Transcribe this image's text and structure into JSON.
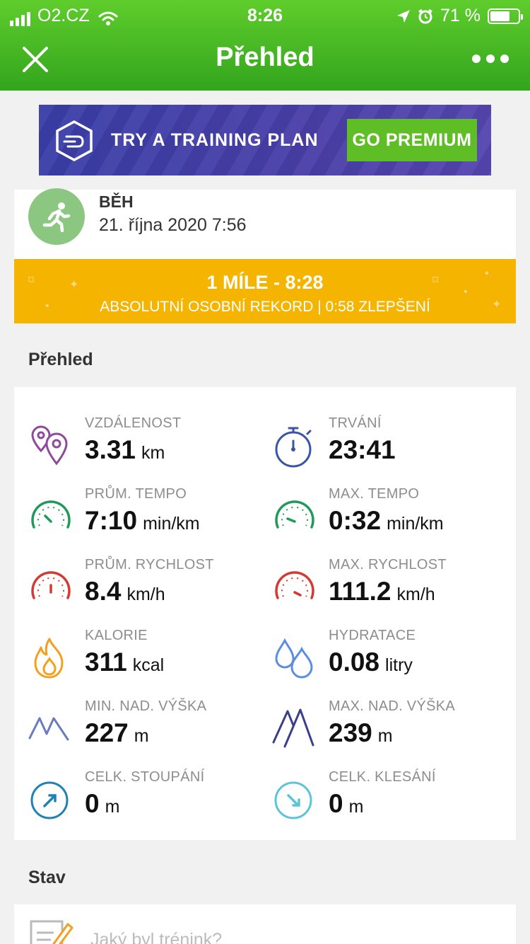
{
  "status_bar": {
    "carrier": "O2.CZ",
    "time": "8:26",
    "battery": "71 %",
    "battery_level": 0.71
  },
  "nav": {
    "title": "Přehled"
  },
  "promo": {
    "label": "TRY A TRAINING PLAN",
    "button": "GO PREMIUM"
  },
  "activity": {
    "type": "BĚH",
    "date": "21. října 2020 7:56"
  },
  "record": {
    "title": "1 MÍLE - 8:28",
    "subtitle": "ABSOLUTNÍ OSOBNÍ REKORD  |  0:58 ZLEPŠENÍ"
  },
  "overview": {
    "title": "Přehled",
    "stats": [
      {
        "label": "VZDÁLENOST",
        "value": "3.31",
        "unit": "km",
        "icon": "location-pins-icon",
        "color": "#8e4a9c"
      },
      {
        "label": "TRVÁNÍ",
        "value": "23:41",
        "unit": "",
        "icon": "stopwatch-icon",
        "color": "#3b55a3"
      },
      {
        "label": "PRŮM. TEMPO",
        "value": "7:10",
        "unit": "min/km",
        "icon": "gauge-icon",
        "color": "#1f9a5a"
      },
      {
        "label": "MAX. TEMPO",
        "value": "0:32",
        "unit": "min/km",
        "icon": "gauge-icon",
        "color": "#1f9a5a"
      },
      {
        "label": "PRŮM. RYCHLOST",
        "value": "8.4",
        "unit": "km/h",
        "icon": "gauge-icon",
        "color": "#d23a32"
      },
      {
        "label": "MAX. RYCHLOST",
        "value": "111.2",
        "unit": "km/h",
        "icon": "gauge-icon",
        "color": "#d23a32"
      },
      {
        "label": "KALORIE",
        "value": "311",
        "unit": "kcal",
        "icon": "flame-icon",
        "color": "#f2a01e"
      },
      {
        "label": "HYDRATACE",
        "value": "0.08",
        "unit": "litry",
        "icon": "water-drops-icon",
        "color": "#5b8ee0"
      },
      {
        "label": "MIN. NAD. VÝŠKA",
        "value": "227",
        "unit": "m",
        "icon": "mountain-icon",
        "color": "#6a7bc0"
      },
      {
        "label": "MAX. NAD. VÝŠKA",
        "value": "239",
        "unit": "m",
        "icon": "mountain-icon",
        "color": "#3a3f8c"
      },
      {
        "label": "CELK. STOUPÁNÍ",
        "value": "0",
        "unit": "m",
        "icon": "ascent-icon",
        "color": "#1f82b5"
      },
      {
        "label": "CELK. KLESÁNÍ",
        "value": "0",
        "unit": "m",
        "icon": "descent-icon",
        "color": "#5cc4d8"
      }
    ]
  },
  "stav": {
    "title": "Stav",
    "placeholder": "Jaký byl trénink?"
  }
}
